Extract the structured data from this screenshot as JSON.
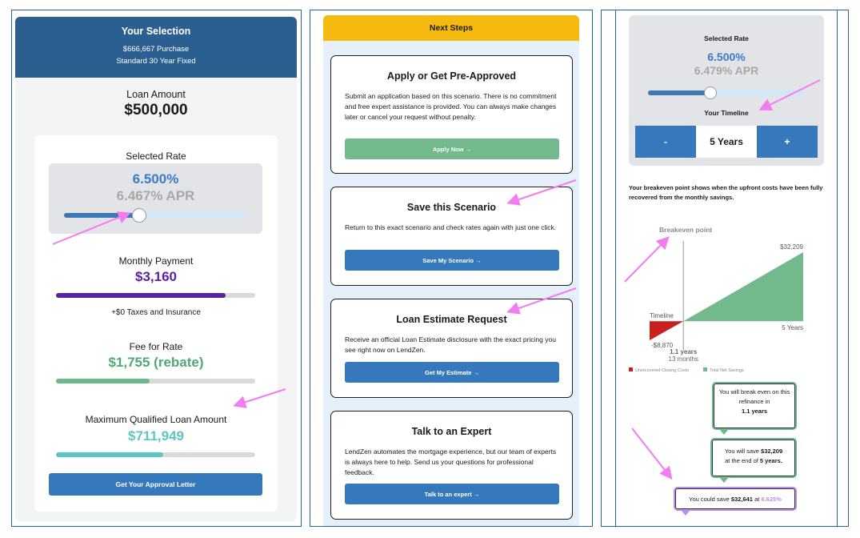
{
  "selection": {
    "title": "Your Selection",
    "purchase": "$666,667 Purchase",
    "product": "Standard 30 Year Fixed",
    "loan_amount_label": "Loan Amount",
    "loan_amount": "$500,000",
    "selected_rate_label": "Selected Rate",
    "rate": "6.500%",
    "apr": "6.467% APR",
    "rate_slider_position": 0.41,
    "monthly_payment_label": "Monthly Payment",
    "monthly_payment": "$3,160",
    "monthly_payment_bar": 0.85,
    "taxes_note": "+$0 Taxes and Insurance",
    "fee_label": "Fee for Rate",
    "fee": "$1,755 (rebate)",
    "fee_bar": 0.47,
    "max_loan_label": "Maximum Qualified Loan Amount",
    "max_loan": "$711,949",
    "max_loan_bar": 0.54,
    "approval_button": "Get Your Approval Letter",
    "colors": {
      "header": "#2b5f8f",
      "rate": "#3a7dc4",
      "payment": "#5b1fa4",
      "fee": "#4fa877",
      "max_loan": "#5cc6c6",
      "button": "#3578bb"
    }
  },
  "next_steps": {
    "title": "Next Steps",
    "steps": [
      {
        "title": "Apply or Get Pre-Approved",
        "description": "Submit an application based on this scenario. There is no commitment and free expert assistance is provided. You can always make changes later or cancel your request without penalty.",
        "button": "Apply Now",
        "button_color": "#72b98d"
      },
      {
        "title": "Save this Scenario",
        "description": "Return to this exact scenario and check rates again with just one click.",
        "button": "Save My Scenario",
        "button_color": "#3578bb"
      },
      {
        "title": "Loan Estimate Request",
        "description": "Receive an official Loan Estimate disclosure with the exact pricing you see right now on LendZen.",
        "button": "Get My Estimate",
        "button_color": "#3578bb"
      },
      {
        "title": "Talk to an Expert",
        "description": "LendZen automates the mortgage experience, but our team of experts is always here to help. Send us your questions for professional feedback.",
        "button": "Talk to an expert",
        "button_color": "#3578bb"
      }
    ],
    "header_color": "#f5b90f"
  },
  "timeline": {
    "selected_rate_label": "Selected Rate",
    "rate": "6.500%",
    "apr": "6.479% APR",
    "rate_slider_position": 0.4,
    "timeline_label": "Your Timeline",
    "minus": "-",
    "plus": "+",
    "years": "5 Years",
    "breakeven_description": "Your breakeven point shows when the upfront costs have been fully recovered from the monthly savings.",
    "bubbles": [
      {
        "prefix": "You will break even on this refinance in",
        "value": "1.1 years"
      },
      {
        "prefix": "You will save",
        "value": "$32,209",
        "middle": "at the end of",
        "value2": "5 years",
        "suffix": "."
      },
      {
        "prefix": "You could save",
        "value": "$32,641",
        "middle": "at",
        "value2": "6.625%"
      }
    ],
    "colors": {
      "savings": "#72b98d",
      "costs": "#c8201e",
      "highlight": "#b890e6"
    }
  },
  "chart_data": {
    "type": "area",
    "annotations": [
      "Breakeven point",
      "Timeline"
    ],
    "x_labels": [
      "1.1 years",
      "13 months",
      "5 Years"
    ],
    "y_labels": [
      "$32,209",
      "-$8,870"
    ],
    "series": [
      {
        "name": "Unrecovered Closing Costs",
        "x": [
          0,
          1.1
        ],
        "y": [
          -8870,
          0
        ]
      },
      {
        "name": "Total Net Savings",
        "x": [
          1.1,
          5
        ],
        "y": [
          0,
          32209
        ]
      }
    ],
    "xlim": [
      0,
      5
    ],
    "ylim": [
      -8870,
      32209
    ],
    "legend": "bottom-left"
  }
}
